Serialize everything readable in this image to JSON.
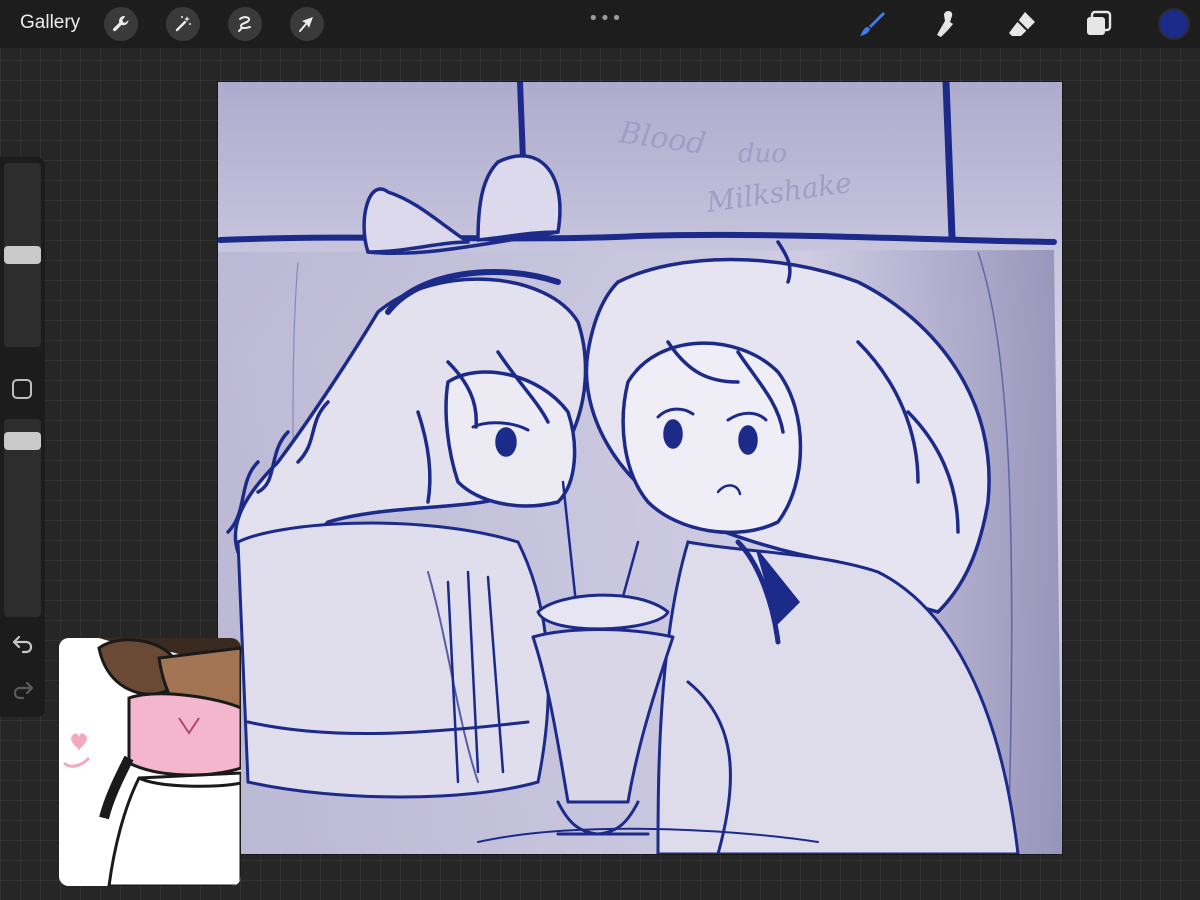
{
  "topbar": {
    "gallery_label": "Gallery",
    "action_tools": [
      {
        "name": "wrench-icon"
      },
      {
        "name": "magic-wand-icon"
      },
      {
        "name": "selection-icon"
      },
      {
        "name": "transform-arrow-icon"
      }
    ],
    "more_dots": "•••",
    "paint_tools": [
      {
        "name": "brush-icon",
        "active": true
      },
      {
        "name": "smudge-icon",
        "active": false
      },
      {
        "name": "eraser-icon",
        "active": false
      },
      {
        "name": "layers-icon",
        "active": false
      }
    ],
    "current_color": "#1c2a8a"
  },
  "sidebar": {
    "brush_size_level": 0.5,
    "opacity_level": 0.93,
    "icons": [
      "modify-square-icon",
      "undo-icon",
      "redo-icon"
    ]
  },
  "canvas": {
    "background_color": "#c9c6de",
    "ink_color": "#1c2a8a",
    "scribble_text": [
      "Blood",
      "duo",
      "Milkshake"
    ]
  },
  "reference_window": {
    "background_color": "#ffffff"
  }
}
